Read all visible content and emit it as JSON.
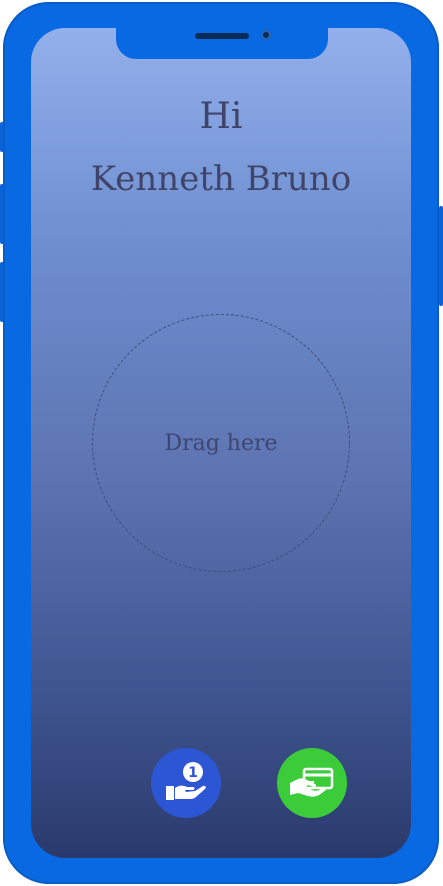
{
  "greeting": {
    "hi": "Hi",
    "name": "Kenneth Bruno"
  },
  "drop_zone": {
    "label": "Drag here"
  },
  "actions": [
    {
      "name": "receive",
      "icon": "hand-coin-icon",
      "badge": "1",
      "color": "#2d56d4"
    },
    {
      "name": "pay",
      "icon": "card-payment-icon",
      "color": "#3ccc3a"
    }
  ],
  "colors": {
    "frame": "#0869e3",
    "screen_top": "#93b0ec",
    "screen_bottom": "#2b3a6c",
    "text": "#40446a"
  }
}
